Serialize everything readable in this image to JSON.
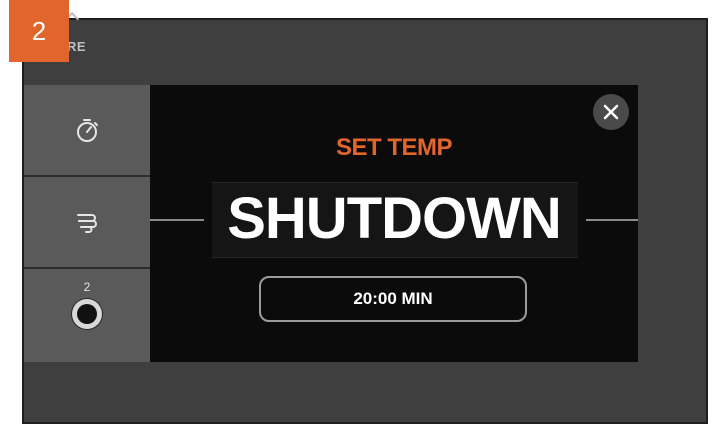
{
  "step": {
    "number": "2"
  },
  "header": {
    "label": "RE"
  },
  "sidebar": {
    "items": [
      {
        "icon": "stopwatch-icon"
      },
      {
        "icon": "smoke-icon"
      },
      {
        "icon": "probe-jack-icon",
        "label": "2"
      }
    ]
  },
  "modal": {
    "subtitle": "SET TEMP",
    "title": "SHUTDOWN",
    "timer": "20:00 MIN",
    "close_icon": "close-icon"
  },
  "colors": {
    "accent": "#e1652d",
    "background": "#3f3f40",
    "sidebar": "#5a5a5b",
    "modal": "#0b0b0b"
  }
}
